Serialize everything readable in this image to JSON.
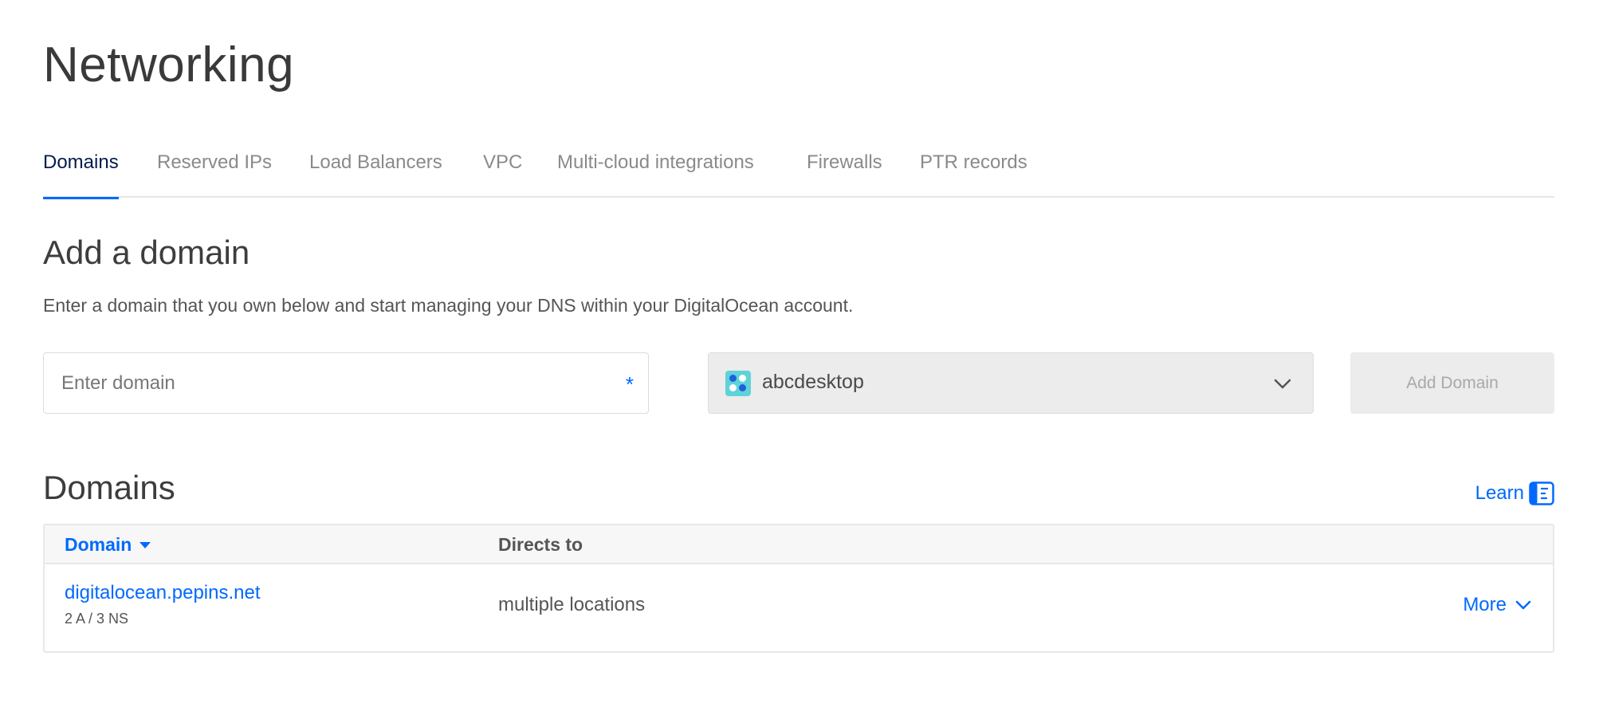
{
  "page": {
    "title": "Networking"
  },
  "tabs": [
    {
      "label": "Domains",
      "active": true
    },
    {
      "label": "Reserved IPs",
      "active": false
    },
    {
      "label": "Load Balancers",
      "active": false
    },
    {
      "label": "VPC",
      "active": false
    },
    {
      "label": "Multi-cloud integrations",
      "active": false
    },
    {
      "label": "Firewalls",
      "active": false
    },
    {
      "label": "PTR records",
      "active": false
    }
  ],
  "add_domain": {
    "title": "Add a domain",
    "description": "Enter a domain that you own below and start managing your DNS within your DigitalOcean account.",
    "input_placeholder": "Enter domain",
    "input_value": "",
    "required_mark": "*",
    "project_select": {
      "value": "abcdesktop",
      "icon": "project-icon"
    },
    "button_label": "Add Domain"
  },
  "domains": {
    "title": "Domains",
    "learn_label": "Learn",
    "columns": {
      "domain": "Domain",
      "directs_to": "Directs to"
    },
    "rows": [
      {
        "domain": "digitalocean.pepins.net",
        "records": "2 A / 3 NS",
        "directs_to": "multiple locations",
        "more_label": "More"
      }
    ]
  },
  "colors": {
    "accent": "#0069ff",
    "active_tab_text": "#031b4e",
    "disabled_bg": "#ececec",
    "project_icon_bg": "#5fd3d8"
  }
}
